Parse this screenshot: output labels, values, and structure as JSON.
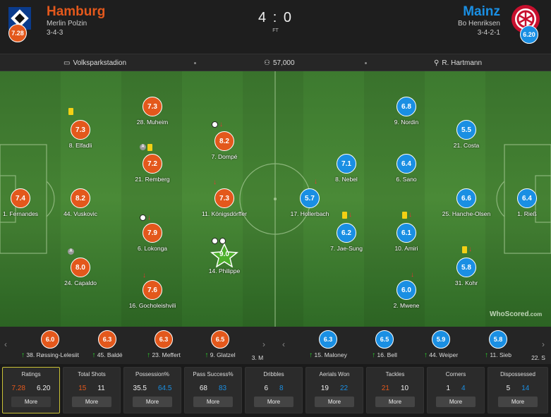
{
  "header": {
    "home": {
      "name": "Hamburg",
      "manager": "Merlin Polzin",
      "formation": "3-4-3",
      "rating": "7.28",
      "color": "#e3581c"
    },
    "away": {
      "name": "Mainz",
      "manager": "Bo Henriksen",
      "formation": "3-4-2-1",
      "rating": "6.20",
      "color": "#1a8fe3"
    },
    "score": "4 : 0",
    "status": "FT"
  },
  "info": {
    "stadium": "Volksparkstadion",
    "attendance": "57,000",
    "referee": "R. Hartmann"
  },
  "home_players": [
    {
      "rating": "7.4",
      "name": "1. Fernandes"
    },
    {
      "rating": "7.3",
      "name": "8. Elfadli"
    },
    {
      "rating": "8.2",
      "name": "44. Vuskovic"
    },
    {
      "rating": "8.0",
      "name": "24. Capaldo"
    },
    {
      "rating": "7.3",
      "name": "28. Muheim"
    },
    {
      "rating": "7.2",
      "name": "21. Remberg"
    },
    {
      "rating": "7.9",
      "name": "6. Lokonga"
    },
    {
      "rating": "7.6",
      "name": "16. Gocholeishvili"
    },
    {
      "rating": "8.2",
      "name": "7. Dompé"
    },
    {
      "rating": "7.3",
      "name": "11. Königsdörffer"
    },
    {
      "rating": "9.0",
      "name": "14. Philippe"
    }
  ],
  "away_players": [
    {
      "rating": "6.4",
      "name": "1. Rieß"
    },
    {
      "rating": "5.5",
      "name": "21. Costa"
    },
    {
      "rating": "6.6",
      "name": "25. Hanche-Olsen"
    },
    {
      "rating": "5.8",
      "name": "31. Kohr"
    },
    {
      "rating": "6.8",
      "name": "9. Nordin"
    },
    {
      "rating": "6.4",
      "name": "6. Sano"
    },
    {
      "rating": "6.1",
      "name": "10. Amiri"
    },
    {
      "rating": "6.0",
      "name": "2. Mwene"
    },
    {
      "rating": "7.1",
      "name": "8. Nebel"
    },
    {
      "rating": "6.2",
      "name": "7. Jae-Sung"
    },
    {
      "rating": "5.7",
      "name": "17. Hollerbach"
    }
  ],
  "home_subs": [
    {
      "rating": "6.0",
      "name": "38. Røssing-Lelesiit"
    },
    {
      "rating": "6.3",
      "name": "45. Baldé"
    },
    {
      "rating": "6.3",
      "name": "23. Meffert"
    },
    {
      "rating": "6.5",
      "name": "9. Glatzel"
    },
    {
      "rating": "",
      "name": "3. M"
    }
  ],
  "away_subs": [
    {
      "rating": "6.3",
      "name": "15. Maloney"
    },
    {
      "rating": "6.5",
      "name": "16. Bell"
    },
    {
      "rating": "5.9",
      "name": "44. Weiper"
    },
    {
      "rating": "5.8",
      "name": "11. Sieb"
    },
    {
      "rating": "",
      "name": "22. S"
    }
  ],
  "watermark": "WhoScored",
  "stats": [
    {
      "title": "Ratings",
      "home": "7.28",
      "away": "6.20",
      "more": "More"
    },
    {
      "title": "Total Shots",
      "home": "15",
      "away": "11",
      "more": "More"
    },
    {
      "title": "Possession%",
      "home": "35.5",
      "away": "64.5",
      "more": "More"
    },
    {
      "title": "Pass Success%",
      "home": "68",
      "away": "83",
      "more": "More"
    },
    {
      "title": "Dribbles",
      "home": "6",
      "away": "8",
      "more": "More"
    },
    {
      "title": "Aerials Won",
      "home": "19",
      "away": "22",
      "more": "More"
    },
    {
      "title": "Tackles",
      "home": "21",
      "away": "10",
      "more": "More"
    },
    {
      "title": "Corners",
      "home": "1",
      "away": "4",
      "more": "More"
    },
    {
      "title": "Dispossessed",
      "home": "5",
      "away": "14",
      "more": "More"
    }
  ]
}
